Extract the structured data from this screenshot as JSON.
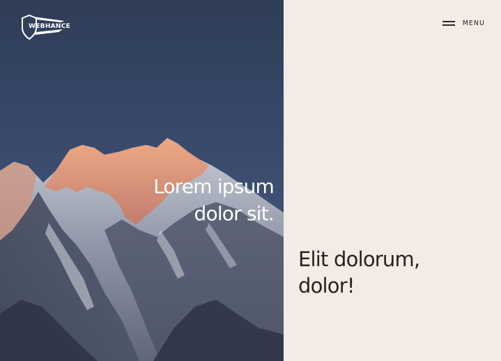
{
  "brand": {
    "logo_text": "WEBHANCE",
    "logo_icon": "shield-icon"
  },
  "menu": {
    "label": "MENU",
    "icon": "hamburger-icon"
  },
  "hero_left": {
    "line1": "Lorem ipsum",
    "line2": "dolor sit."
  },
  "hero_right": {
    "line1": "Elit dolorum,",
    "line2": "dolor!"
  },
  "colors": {
    "sky": "#38486a",
    "panel_right": "#f3ece6",
    "text_dark": "#2d201b",
    "text_light": "#ffffff",
    "peak_glow": "#e8946a"
  }
}
